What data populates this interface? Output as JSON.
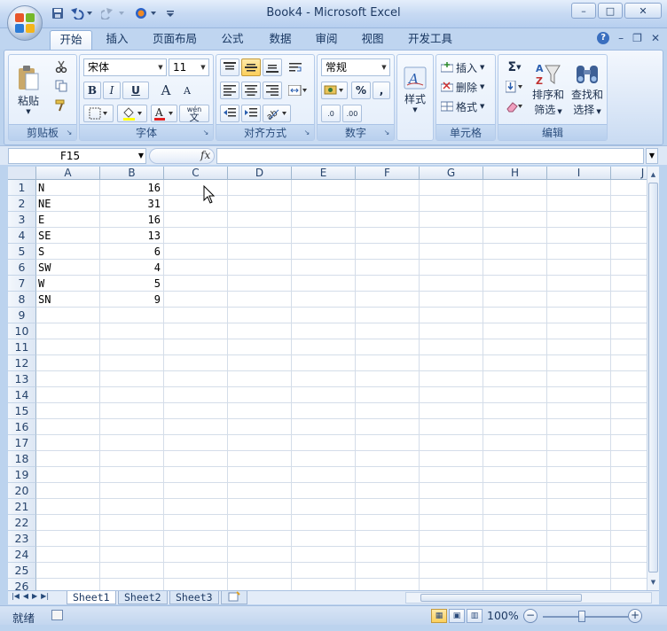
{
  "window": {
    "title": "Book4 - Microsoft Excel",
    "minimize": "–",
    "maximize": "□",
    "close": "✕"
  },
  "ribbon_tabs": [
    "开始",
    "插入",
    "页面布局",
    "公式",
    "数据",
    "审阅",
    "视图",
    "开发工具"
  ],
  "ribbon_help": {
    "help": "?",
    "min": "–",
    "restore": "❐",
    "close": "✕"
  },
  "clipboard": {
    "paste_label": "粘贴",
    "group_label": "剪贴板"
  },
  "font": {
    "name": "宋体",
    "size": "11",
    "bold": "B",
    "italic": "I",
    "underline": "U",
    "grow": "A",
    "shrink": "A",
    "phonetic": "wén",
    "phonetic2": "文",
    "group_label": "字体"
  },
  "alignment": {
    "group_label": "对齐方式"
  },
  "number": {
    "format": "常规",
    "percent": "%",
    "comma": ",",
    "inc": ".0",
    "dec": ".00",
    "group_label": "数字"
  },
  "styles": {
    "label": "样式"
  },
  "cells_group": {
    "insert": "插入",
    "delete": "删除",
    "format": "格式",
    "group_label": "单元格"
  },
  "editing": {
    "sigma": "Σ",
    "sort_filter_1": "排序和",
    "sort_filter_2": "筛选",
    "find_select_1": "查找和",
    "find_select_2": "选择",
    "group_label": "编辑"
  },
  "formula_bar": {
    "name_box": "F15",
    "fx": "fx",
    "value": ""
  },
  "columns": [
    "A",
    "B",
    "C",
    "D",
    "E",
    "F",
    "G",
    "H",
    "I",
    "J"
  ],
  "rows": [
    "1",
    "2",
    "3",
    "4",
    "5",
    "6",
    "7",
    "8",
    "9",
    "10",
    "11",
    "12",
    "13",
    "14",
    "15",
    "16",
    "17",
    "18",
    "19",
    "20",
    "21",
    "22",
    "23",
    "24",
    "25",
    "26"
  ],
  "cells": {
    "A": [
      "N",
      "NE",
      "E",
      "SE",
      "S",
      "SW",
      "W",
      "SN"
    ],
    "B": [
      "16",
      "31",
      "16",
      "13",
      "6",
      "4",
      "5",
      "9"
    ]
  },
  "sheet_tabs": [
    "Sheet1",
    "Sheet2",
    "Sheet3"
  ],
  "status": {
    "ready": "就绪",
    "zoom": "100%",
    "zoom_minus": "−",
    "zoom_plus": "+"
  }
}
